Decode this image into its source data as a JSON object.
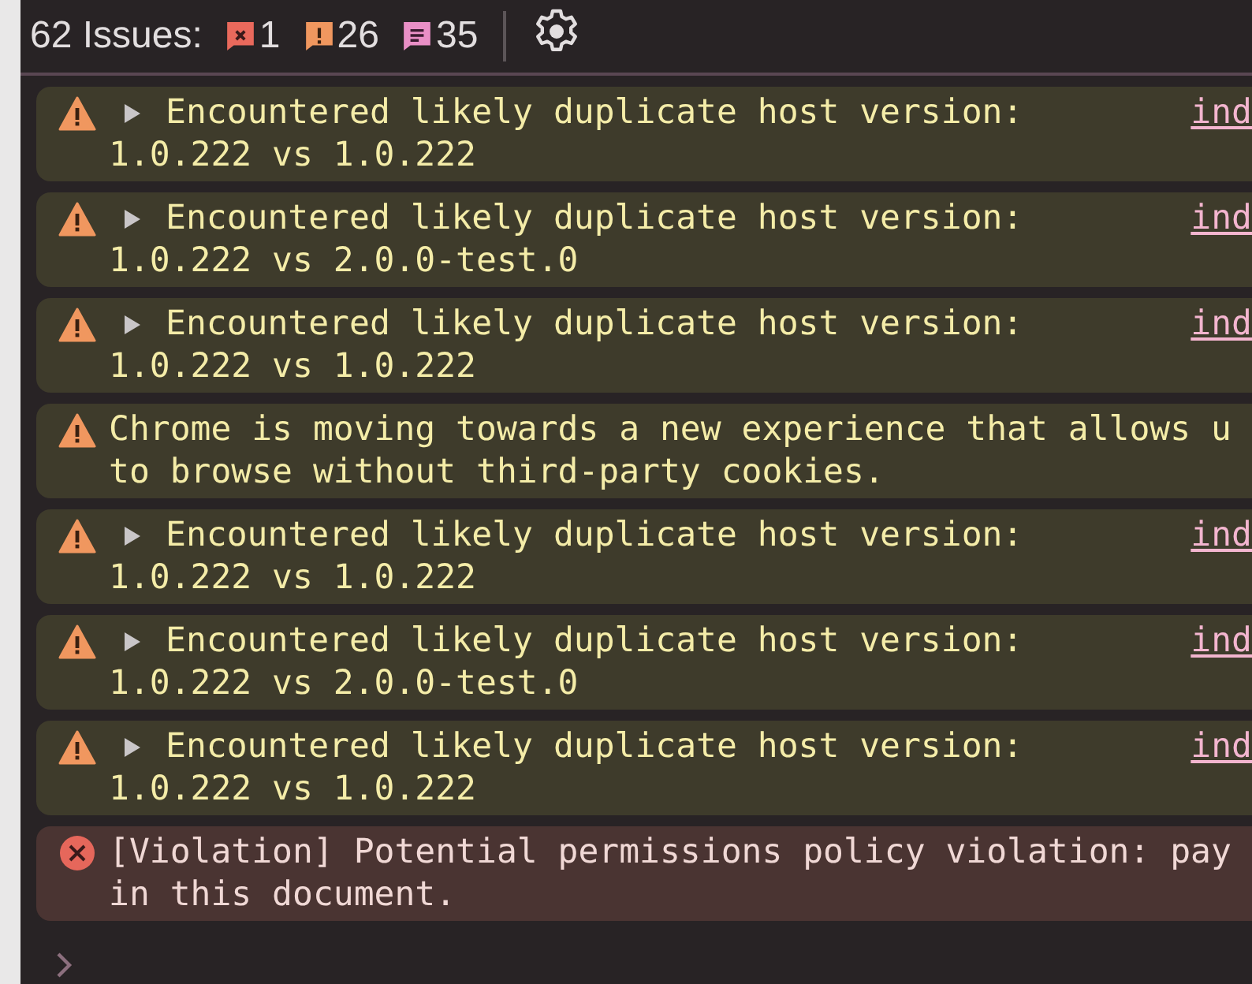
{
  "toolbar": {
    "title": "62 Issues:",
    "badges": [
      {
        "kind": "error",
        "count": "1"
      },
      {
        "kind": "warning",
        "count": "26"
      },
      {
        "kind": "info",
        "count": "35"
      }
    ]
  },
  "messages": [
    {
      "kind": "warning",
      "expanded": false,
      "lines": [
        "Encountered likely duplicate host version:",
        "1.0.222 vs 1.0.222"
      ],
      "link": "ind"
    },
    {
      "kind": "warning",
      "expanded": false,
      "lines": [
        "Encountered likely duplicate host version:",
        "1.0.222 vs 2.0.0-test.0"
      ],
      "link": "ind"
    },
    {
      "kind": "warning",
      "expanded": false,
      "lines": [
        "Encountered likely duplicate host version:",
        "1.0.222 vs 1.0.222"
      ],
      "link": "ind"
    },
    {
      "kind": "warning",
      "lines": [
        "Chrome is moving towards a new experience that allows u",
        "to browse without third-party cookies."
      ]
    },
    {
      "kind": "warning",
      "expanded": false,
      "lines": [
        "Encountered likely duplicate host version:",
        "1.0.222 vs 1.0.222"
      ],
      "link": "ind"
    },
    {
      "kind": "warning",
      "expanded": false,
      "lines": [
        "Encountered likely duplicate host version:",
        "1.0.222 vs 2.0.0-test.0"
      ],
      "link": "ind"
    },
    {
      "kind": "warning",
      "expanded": false,
      "lines": [
        "Encountered likely duplicate host version:",
        "1.0.222 vs 1.0.222"
      ],
      "link": "ind"
    },
    {
      "kind": "error",
      "lines": [
        "[Violation] Potential permissions policy violation: pay",
        "in this document."
      ]
    }
  ]
}
